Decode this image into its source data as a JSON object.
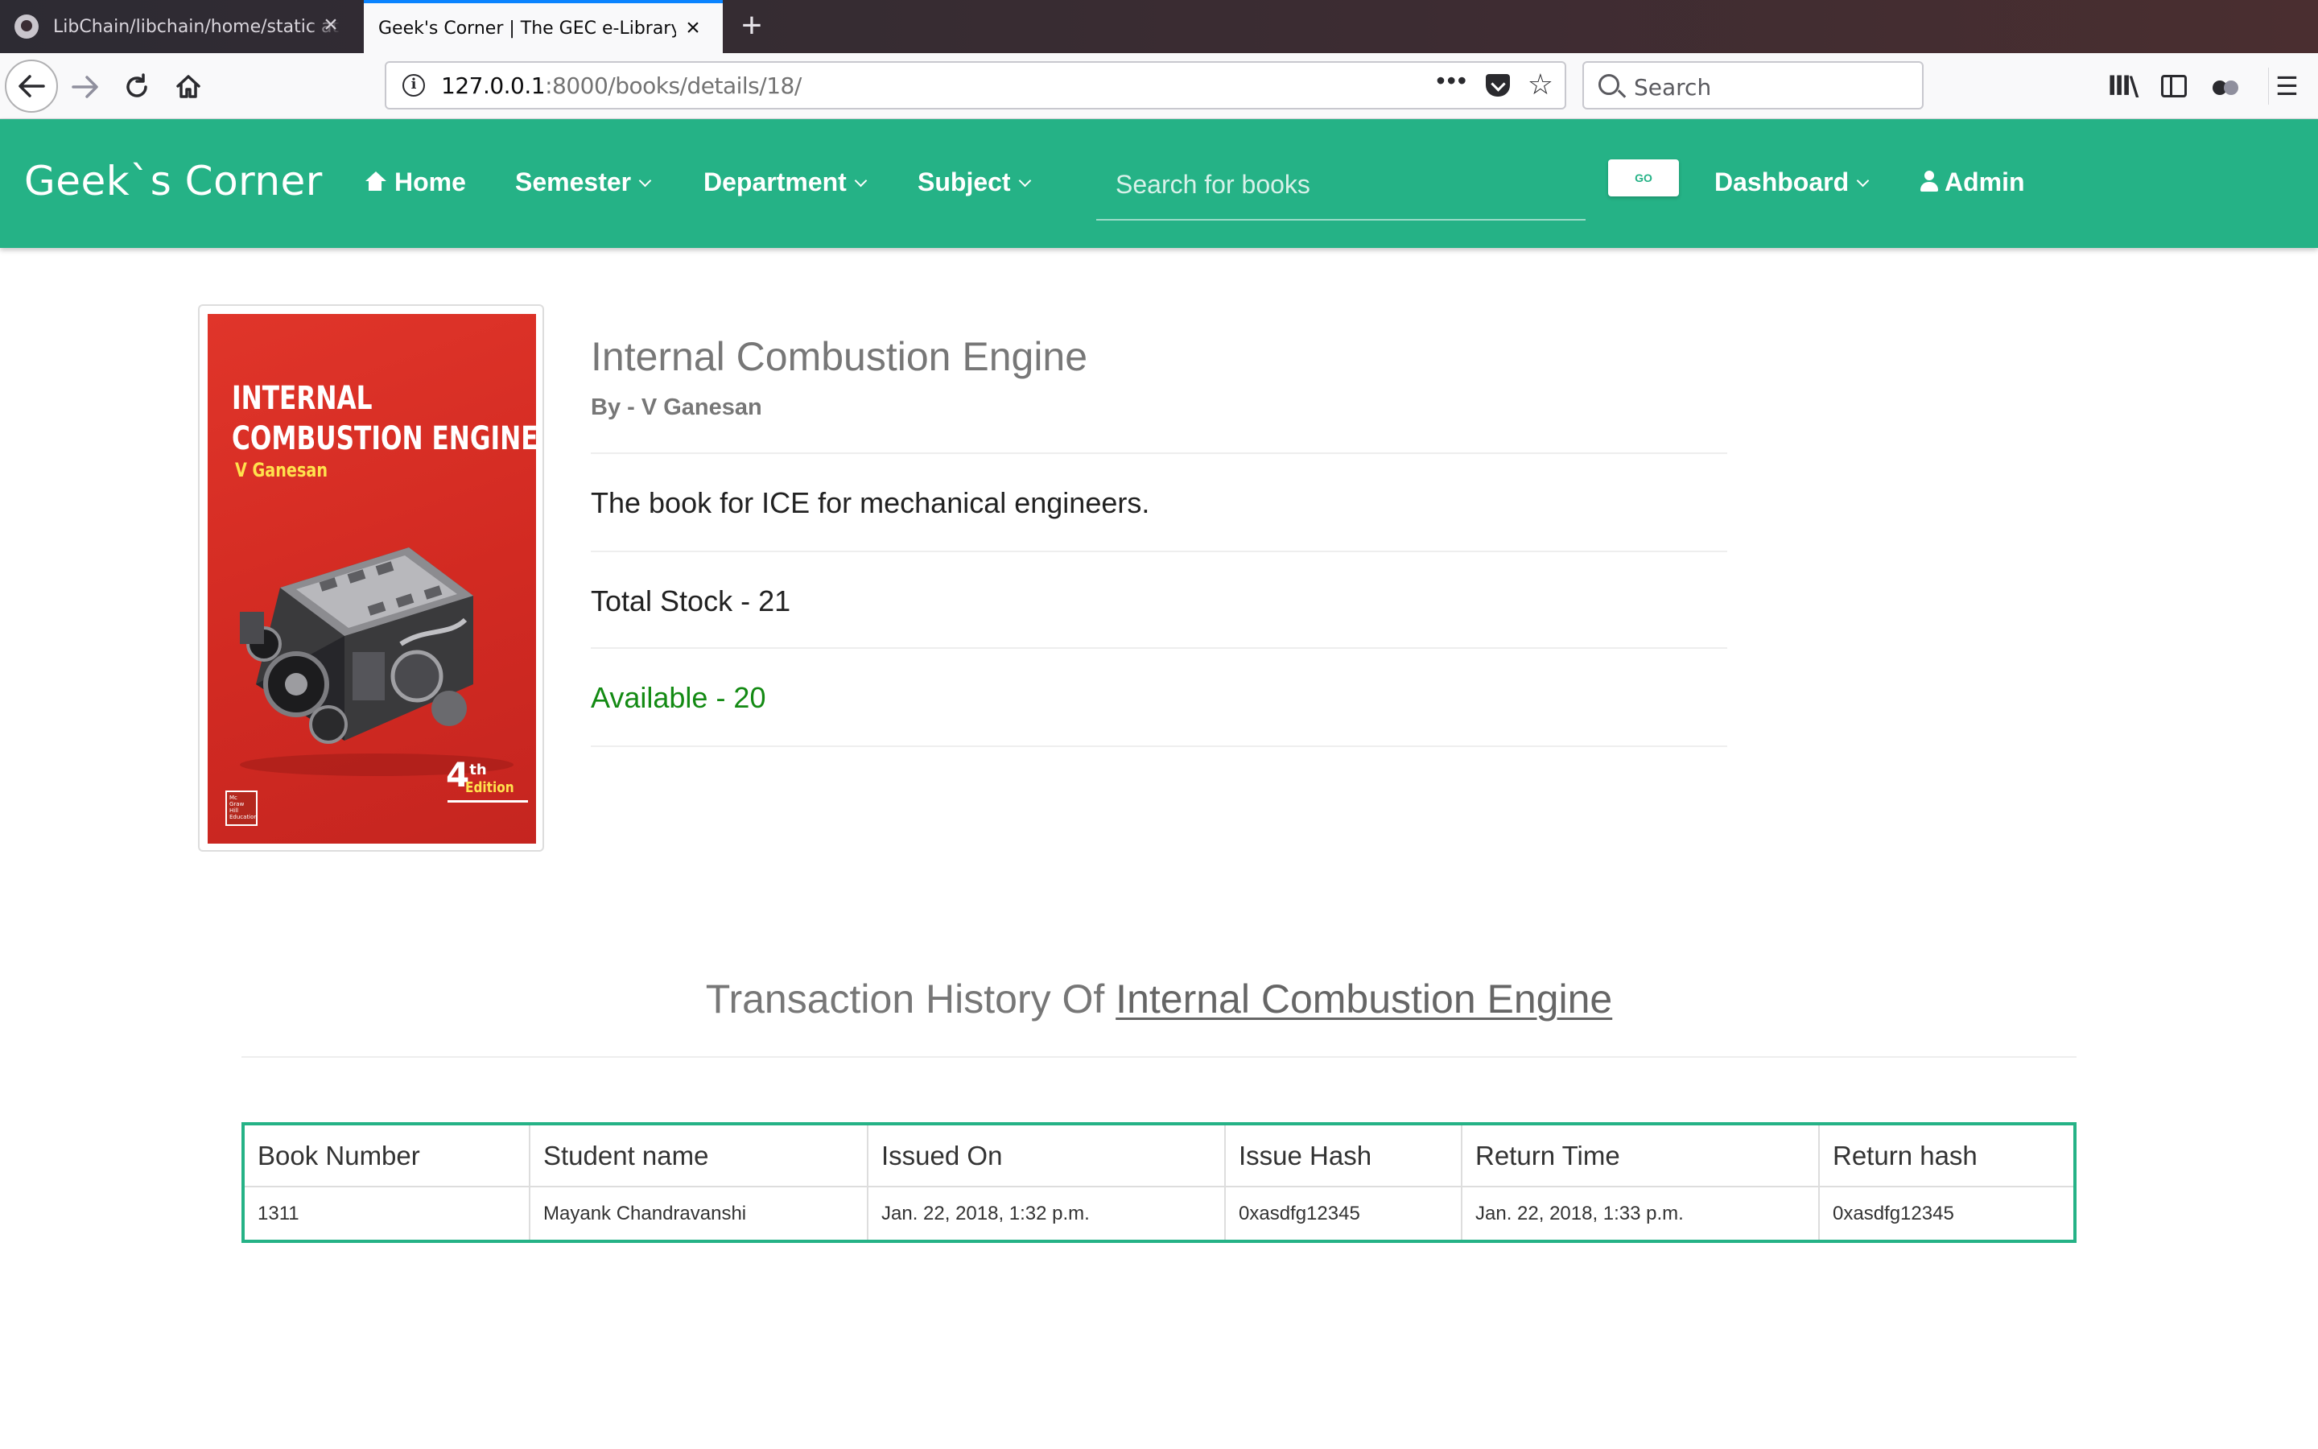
{
  "browser": {
    "tabs": [
      {
        "title": "LibChain/libchain/home/static at",
        "active": false
      },
      {
        "title": "Geek's Corner | The GEC e-Library",
        "active": true
      }
    ],
    "url": {
      "host": "127.0.0.1",
      "rest": ":8000/books/details/18/"
    },
    "search_placeholder": "Search",
    "accent_color": "#0a84ff"
  },
  "navbar": {
    "brand": "Geek`s Corner",
    "color": "#25b286",
    "links": {
      "home": "Home",
      "semester": "Semester",
      "department": "Department",
      "subject": "Subject",
      "dashboard": "Dashboard",
      "admin": "Admin"
    },
    "search_placeholder": "Search for books",
    "go_label": "GO"
  },
  "book": {
    "cover": {
      "title_line1": "INTERNAL",
      "title_line2": "COMBUSTION ENGINES",
      "author": "V Ganesan",
      "edition_num": "4",
      "edition_sup": "th",
      "edition_word": "Edition",
      "publisher": "Mc Graw Hill Education"
    },
    "title": "Internal Combustion Engine",
    "author_line": "By - V Ganesan",
    "description": "The book for ICE for mechanical engineers.",
    "total_stock": "Total Stock - 21",
    "available": "Available - 20",
    "available_color": "#138a13"
  },
  "transactions": {
    "heading_prefix": "Transaction History Of ",
    "heading_link": "Internal Combustion Engine",
    "columns": [
      "Book Number",
      "Student name",
      "Issued On",
      "Issue Hash",
      "Return Time",
      "Return hash"
    ],
    "rows": [
      [
        "1311",
        "Mayank Chandravanshi",
        "Jan. 22, 2018, 1:32 p.m.",
        "0xasdfg12345",
        "Jan. 22, 2018, 1:33 p.m.",
        "0xasdfg12345"
      ]
    ]
  }
}
